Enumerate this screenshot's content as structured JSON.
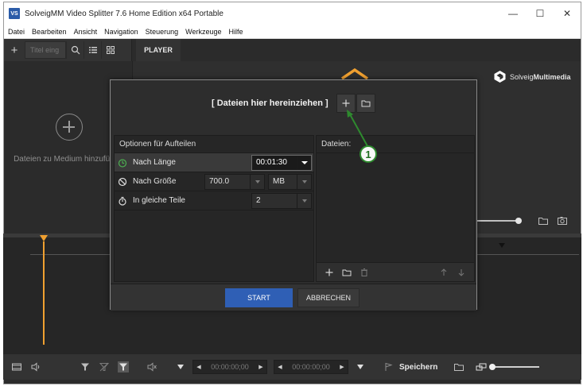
{
  "window": {
    "app_icon_text": "VS",
    "title": "SolveigMM Video Splitter 7.6 Home Edition x64 Portable",
    "controls": {
      "minimize": "—",
      "maximize": "☐",
      "close": "✕"
    }
  },
  "menu": [
    "Datei",
    "Bearbeiten",
    "Ansicht",
    "Navigation",
    "Steuerung",
    "Werkzeuge",
    "Hilfe"
  ],
  "toolbar": {
    "add": "+",
    "search_placeholder": "Titel eing"
  },
  "player_tab": "PLAYER",
  "media_panel": {
    "add_text": "Dateien zu Medium hinzufügen"
  },
  "brand": {
    "prefix": "Solveig",
    "bold": "Multimedia"
  },
  "dialog": {
    "drop_label": "[ Dateien hier hereinziehen ]",
    "options_title": "Optionen für Aufteilen",
    "files_title": "Dateien:",
    "options": [
      {
        "label": "Nach Länge",
        "value": "00:01:30"
      },
      {
        "label": "Nach Größe",
        "value": "700.0",
        "unit": "MB"
      },
      {
        "label": "In gleiche Teile",
        "value": "2"
      }
    ],
    "start_label": "START",
    "cancel_label": "ABBRECHEN"
  },
  "annotation": {
    "number": "1",
    "color": "#2e8a2e"
  },
  "bottombar": {
    "time_start": "00:00:00;00",
    "time_end": "00:00:00;00",
    "save_label": "Speichern"
  },
  "colors": {
    "accent": "#2f5fb5",
    "playhead": "#f0a030",
    "panel": "#2b2b2b"
  }
}
